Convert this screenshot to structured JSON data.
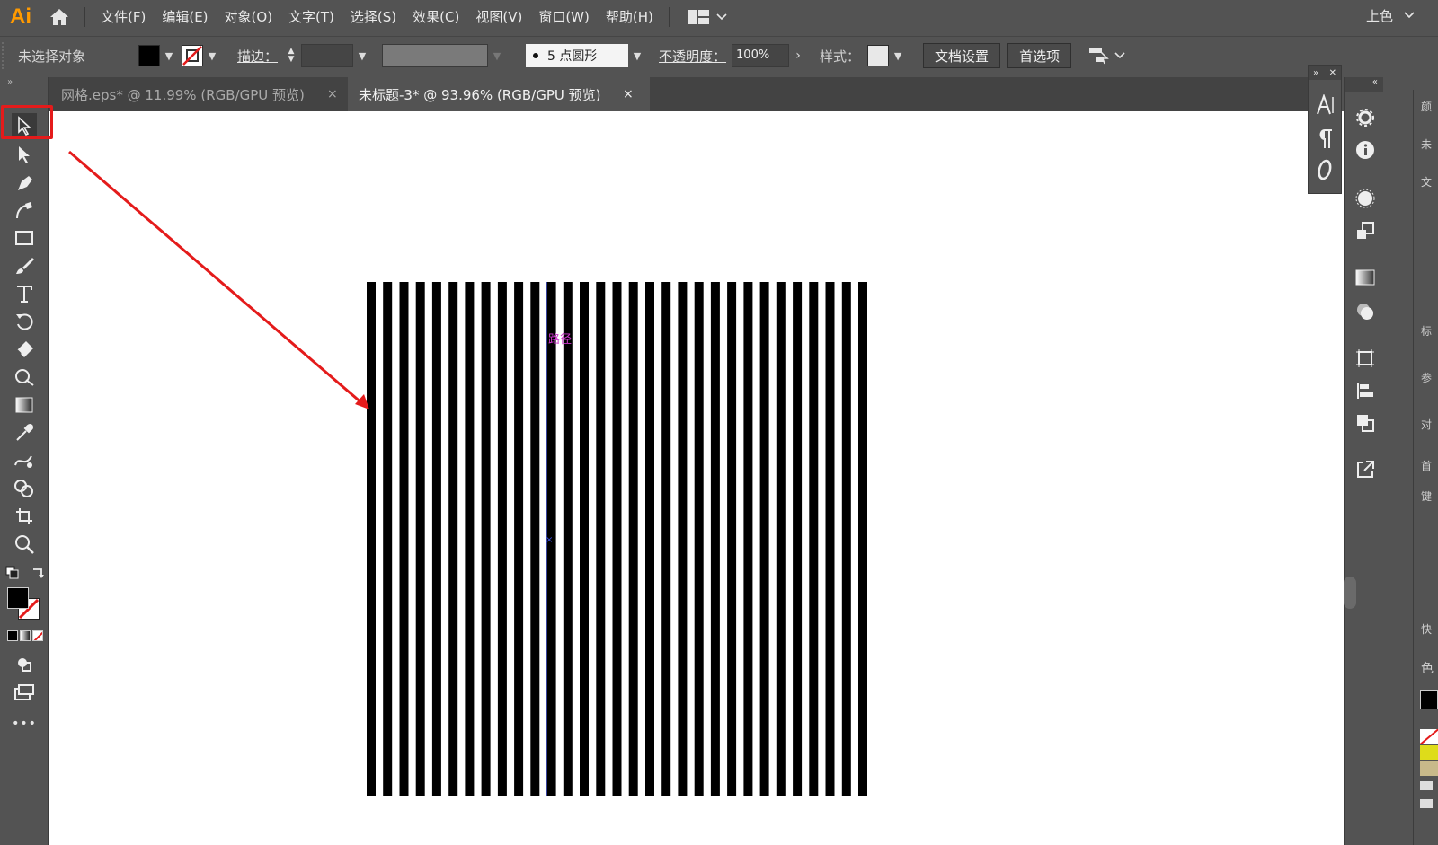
{
  "app": {
    "logo": "Ai"
  },
  "menu": {
    "items": [
      "文件(F)",
      "编辑(E)",
      "对象(O)",
      "文字(T)",
      "选择(S)",
      "效果(C)",
      "视图(V)",
      "窗口(W)",
      "帮助(H)"
    ]
  },
  "workspace": {
    "label": "上色"
  },
  "control": {
    "no_selection": "未选择对象",
    "stroke_label": "描边：",
    "brush_label": "5 点圆形",
    "opacity_label": "不透明度：",
    "opacity_value": "100%",
    "style_label": "样式：",
    "doc_setup": "文档设置",
    "preferences": "首选项"
  },
  "tabs": [
    {
      "label": "网格.eps* @ 11.99% (RGB/GPU 预览)",
      "close": "×"
    },
    {
      "label": "未标题-3* @ 93.96% (RGB/GPU 预览)",
      "close": "×"
    }
  ],
  "canvas": {
    "smart_guide_label": "路径",
    "stripe_count": 31,
    "stripe_color": "#000000"
  },
  "right_panel": {
    "chars": [
      "颜",
      "未",
      "文",
      "标",
      "参",
      "对",
      "首",
      "键",
      "快",
      "色"
    ]
  },
  "colors": {
    "accent": "#e41b1b",
    "chrome": "#535353",
    "artboard": "#ffffff",
    "logo": "#ff9a00",
    "guide": "#cc33cc"
  },
  "more_tools": "•••"
}
